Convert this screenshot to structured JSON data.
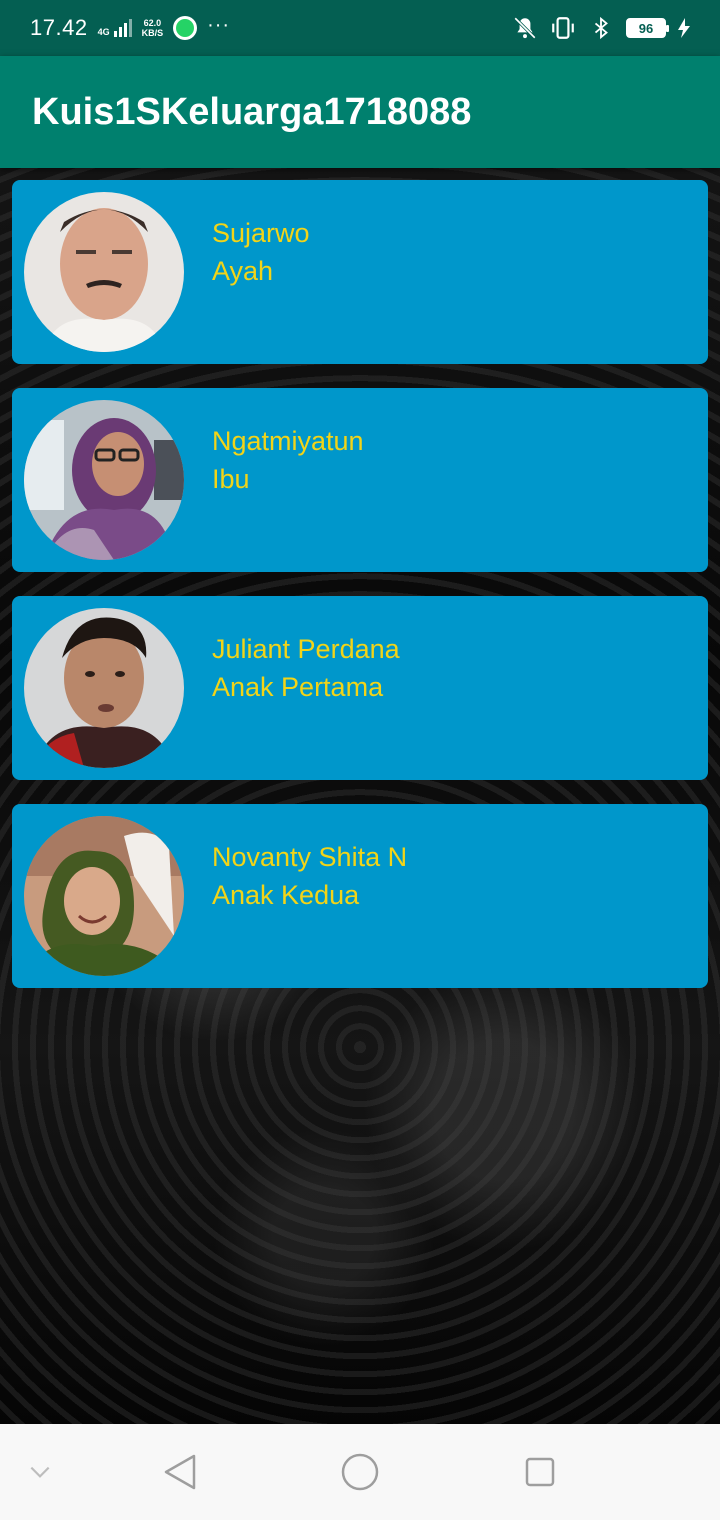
{
  "status_bar": {
    "time": "17.42",
    "network_type": "4G",
    "speed_value": "62.0",
    "speed_unit": "KB/S",
    "more": "···",
    "battery": "96"
  },
  "app_bar": {
    "title": "Kuis1SKeluarga1718088"
  },
  "members": [
    {
      "name": "Sujarwo",
      "role": "Ayah"
    },
    {
      "name": "Ngatmiyatun",
      "role": "Ibu"
    },
    {
      "name": "Juliant Perdana",
      "role": "Anak Pertama"
    },
    {
      "name": "Novanty Shita N",
      "role": "Anak Kedua"
    }
  ],
  "colors": {
    "status_bar": "#045f52",
    "app_bar": "#00806e",
    "card": "#0097cb",
    "card_text": "#f2d418",
    "nav_bar": "#f8f8f8"
  },
  "nav_bar": {
    "icons": [
      "chevron-down-icon",
      "back-icon",
      "home-icon",
      "recents-icon"
    ]
  }
}
